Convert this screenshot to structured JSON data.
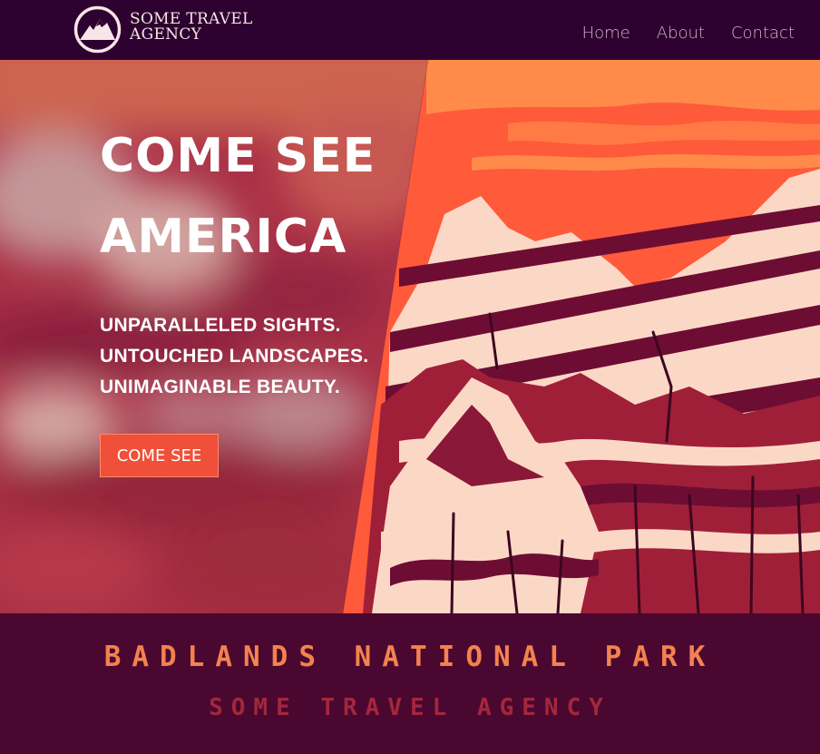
{
  "brand": {
    "name_line1": "SOME TRAVEL",
    "name_line2": "AGENCY",
    "logo_icon": "mountain-logo-icon"
  },
  "nav": {
    "links": [
      "Home",
      "About",
      "Contact"
    ]
  },
  "hero": {
    "title_line1": "COME SEE",
    "title_line2": "AMERICA",
    "tagline": [
      "UNPARALLELED SIGHTS.",
      "UNTOUCHED LANDSCAPES.",
      "UNIMAGINABLE BEAUTY."
    ],
    "cta_label": "COME SEE"
  },
  "band": {
    "title": "BADLANDS NATIONAL PARK",
    "subtitle": "SOME TRAVEL AGENCY"
  },
  "colors": {
    "nav_bg": "#2e0230",
    "band_bg": "#4a0730",
    "accent_orange": "#f04f39",
    "title_orange": "#f2824f",
    "subtitle_red": "#a3273d"
  }
}
